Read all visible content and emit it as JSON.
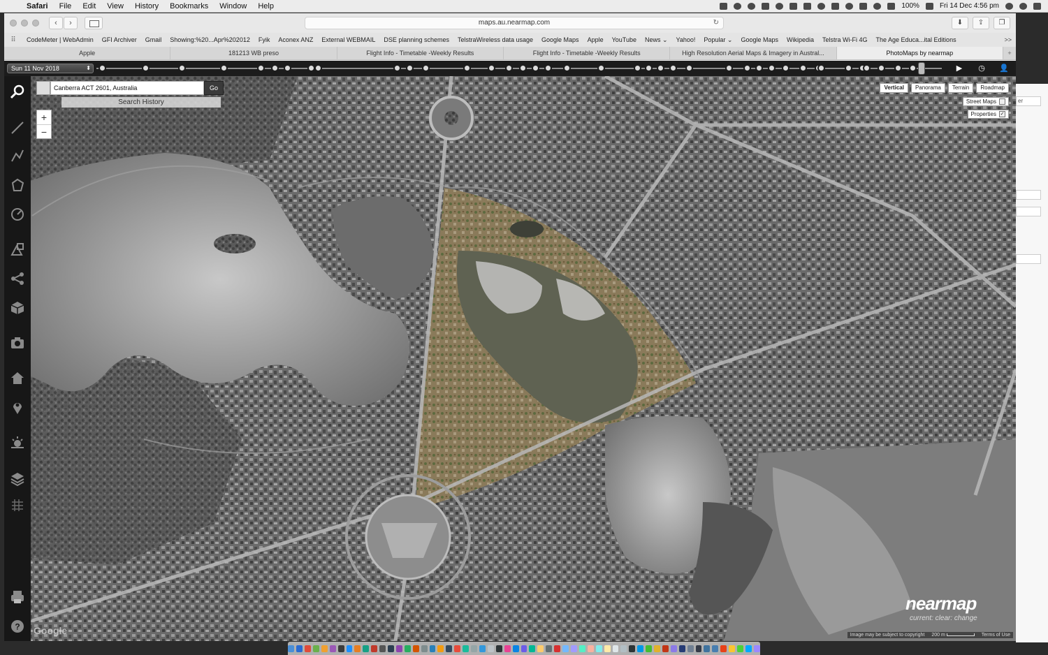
{
  "menubar": {
    "app": "Safari",
    "items": [
      "File",
      "Edit",
      "View",
      "History",
      "Bookmarks",
      "Window",
      "Help"
    ],
    "battery": "100%",
    "datetime": "Fri 14 Dec  4:56 pm"
  },
  "browser": {
    "url": "maps.au.nearmap.com",
    "bookmarks": [
      "CodeMeter | WebAdmin",
      "GFI Archiver",
      "Gmail",
      "Showing:%20...Apr%202012",
      "Fyik",
      "Aconex ANZ",
      "External WEBMAIL",
      "DSE planning schemes",
      "TelstraWireless data usage",
      "Google Maps",
      "Apple",
      "YouTube",
      "News ⌄",
      "Yahoo!",
      "Popular ⌄",
      "Google Maps",
      "Wikipedia",
      "Telstra Wi-Fi 4G",
      "The Age Educa...ital Editions"
    ],
    "bookmarks_more": ">>",
    "tabs": [
      {
        "label": "Apple",
        "active": false
      },
      {
        "label": "181213 WB preso",
        "active": false
      },
      {
        "label": "Flight Info - Timetable -Weekly Results",
        "active": false
      },
      {
        "label": "Flight Info - Timetable -Weekly Results",
        "active": false
      },
      {
        "label": "High Resolution Aerial Maps & Imagery in Austral...",
        "active": false
      },
      {
        "label": "PhotoMaps by nearmap",
        "active": true
      }
    ]
  },
  "timeline": {
    "selected_date": "Sun 11 Nov 2018"
  },
  "search": {
    "value": "Canberra ACT 2601, Australia",
    "go_label": "Go",
    "history_label": "Search History"
  },
  "zoom": {
    "in": "+",
    "out": "−"
  },
  "view_modes": {
    "tabs": [
      "Vertical",
      "Panorama",
      "Terrain",
      "Roadmap"
    ],
    "active": "Vertical",
    "street_maps_label": "Street Maps",
    "properties_label": "Properties",
    "properties_checked": true,
    "street_maps_checked": false
  },
  "branding": {
    "logo": "nearmap",
    "tagline": "current: clear: change",
    "google": "Google"
  },
  "attribution": {
    "copyright": "Image may be subject to copyright",
    "scale": "200 m",
    "terms": "Terms of Use"
  },
  "background_window": {
    "fragment": "er"
  },
  "tools": [
    "search-icon",
    "line-measure-icon",
    "polyline-icon",
    "polygon-icon",
    "radius-icon",
    "shapes-icon",
    "share-icon",
    "3d-box-icon",
    "camera-icon",
    "home-icon",
    "pin-icon",
    "weather-icon",
    "layers-icon",
    "grid-icon",
    "print-icon",
    "help-icon"
  ]
}
